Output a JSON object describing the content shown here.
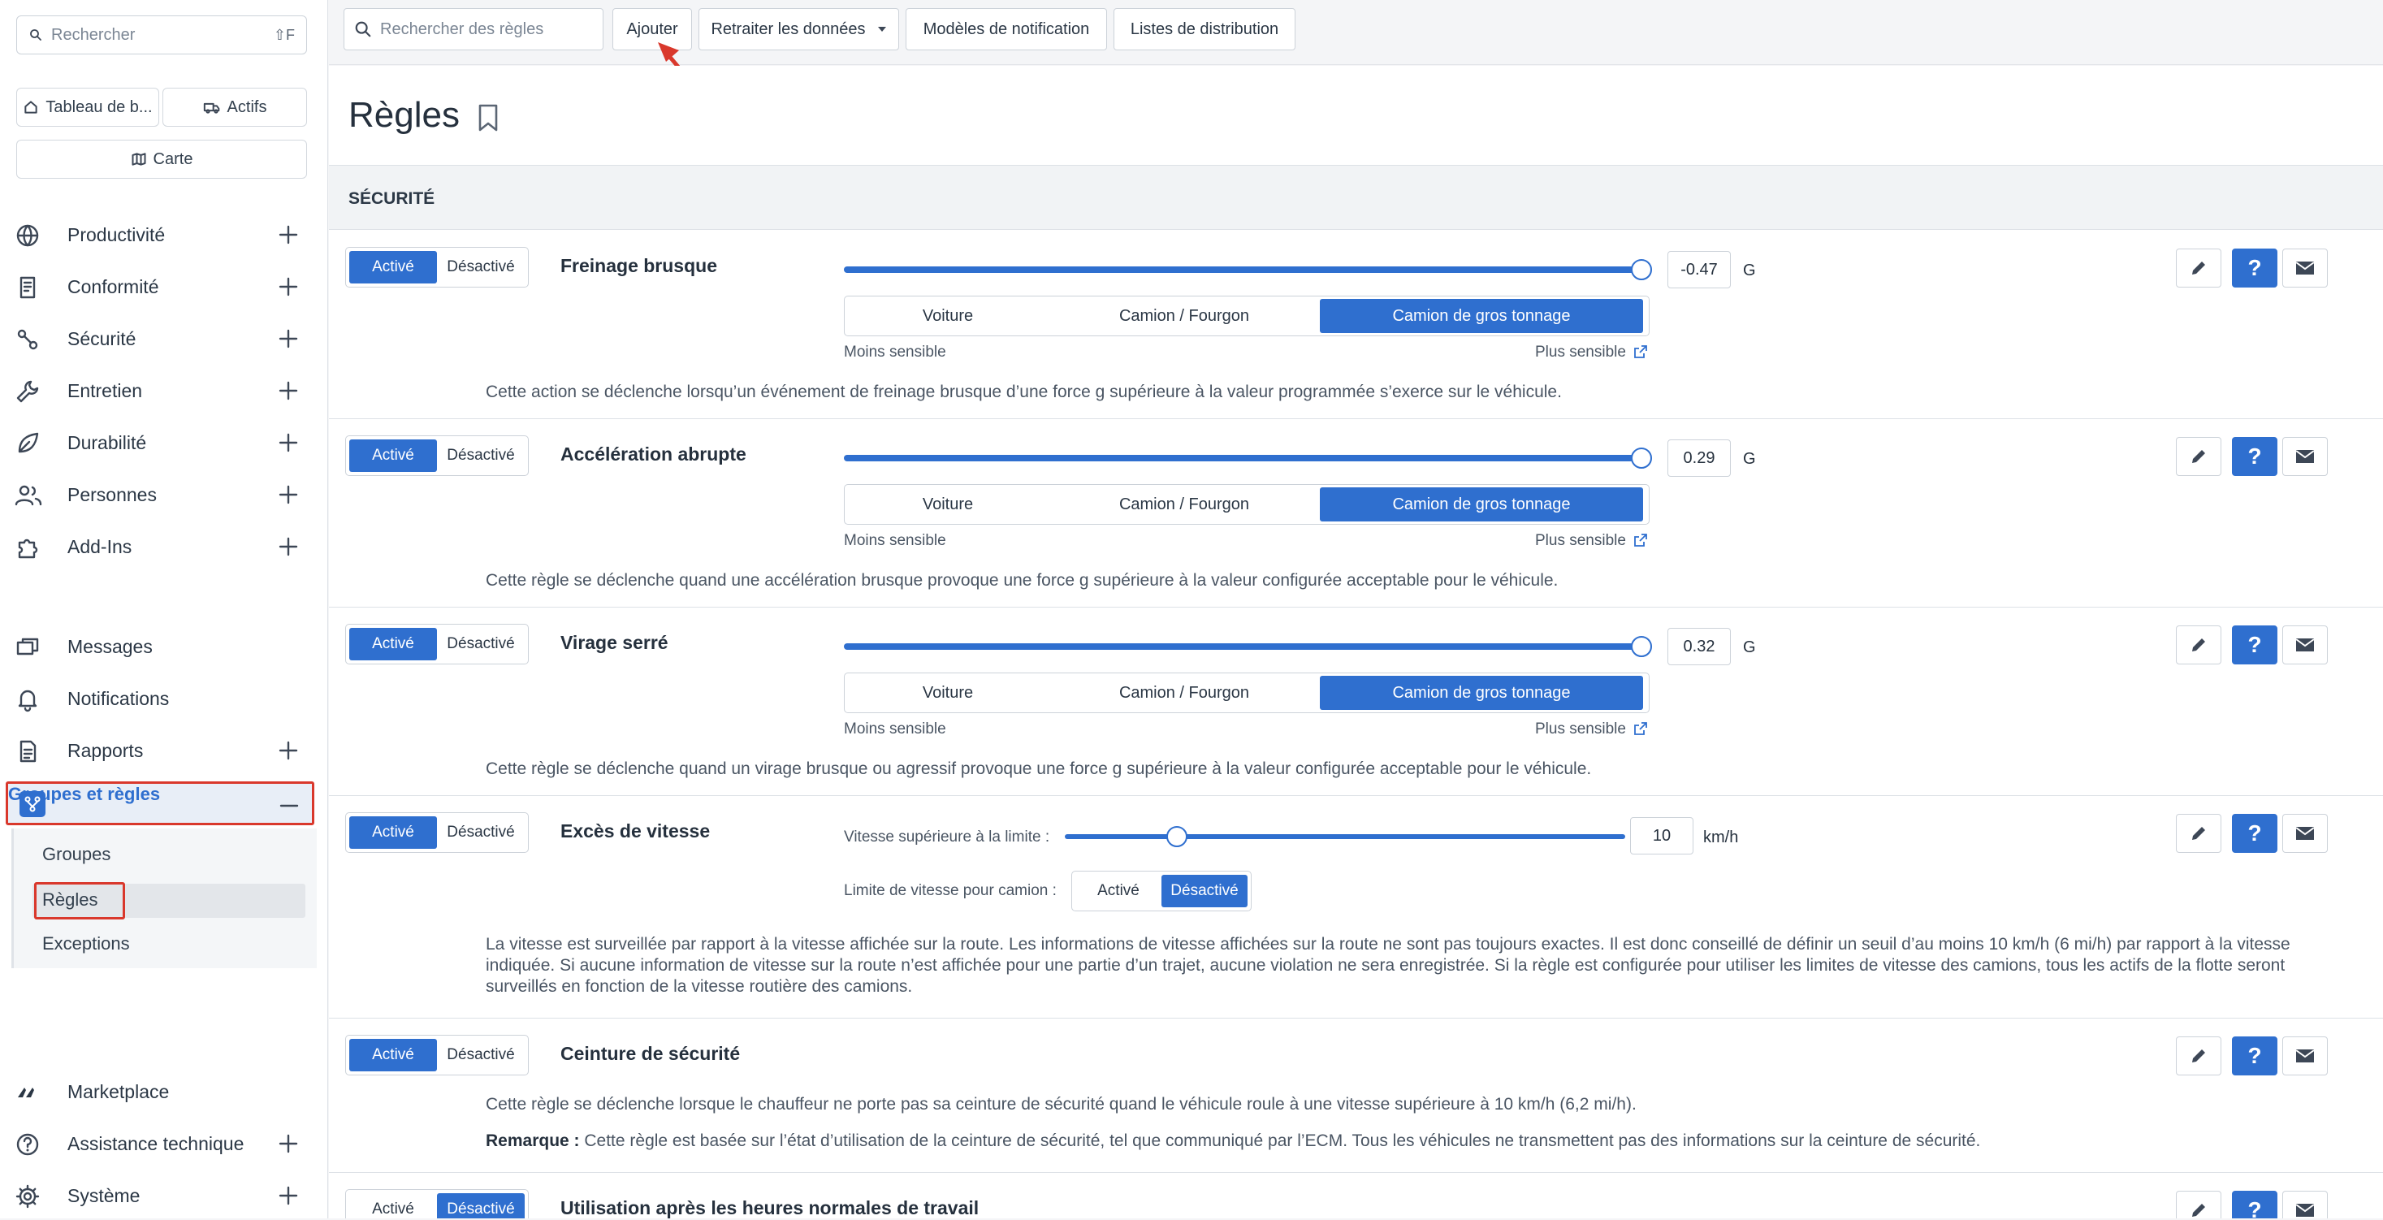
{
  "sidebar": {
    "search_placeholder": "Rechercher",
    "search_shortcut": "⇧F",
    "quick_links": [
      "Tableau de b...",
      "Actifs",
      "Carte"
    ],
    "nav": [
      {
        "label": "Productivité",
        "icon": "globe-icon",
        "expandable": true
      },
      {
        "label": "Conformité",
        "icon": "clipboard-icon",
        "expandable": true
      },
      {
        "label": "Sécurité",
        "icon": "road-icon",
        "expandable": true
      },
      {
        "label": "Entretien",
        "icon": "wrench-icon",
        "expandable": true
      },
      {
        "label": "Durabilité",
        "icon": "leaf-icon",
        "expandable": true
      },
      {
        "label": "Personnes",
        "icon": "people-icon",
        "expandable": true
      },
      {
        "label": "Add-Ins",
        "icon": "puzzle-icon",
        "expandable": true
      },
      {
        "label": "Messages",
        "icon": "messages-icon",
        "expandable": false
      },
      {
        "label": "Notifications",
        "icon": "bell-icon",
        "expandable": false
      },
      {
        "label": "Rapports",
        "icon": "report-icon",
        "expandable": true
      },
      {
        "label": "Groupes et règles",
        "icon": "groups-rules-icon",
        "expanded": true
      },
      {
        "label": "Marketplace",
        "icon": "marketplace-icon",
        "expandable": false
      },
      {
        "label": "Assistance technique",
        "icon": "help-circle-icon",
        "expandable": true
      },
      {
        "label": "Système",
        "icon": "gear-icon",
        "expandable": true
      }
    ],
    "sub_items": [
      "Groupes",
      "Règles",
      "Exceptions"
    ],
    "active_sub_item": "Règles"
  },
  "toolbar": {
    "search_placeholder": "Rechercher des règles",
    "add_label": "Ajouter",
    "reprocess_label": "Retraiter les données",
    "templates_label": "Modèles de notification",
    "distribution_label": "Listes de distribution"
  },
  "page": {
    "title": "Règles",
    "section": "SÉCURITÉ"
  },
  "common": {
    "on_label": "Activé",
    "off_label": "Désactivé",
    "vehicle_types": [
      "Voiture",
      "Camion / Fourgon",
      "Camion de gros tonnage"
    ],
    "less_sensitive": "Moins sensible",
    "more_sensitive": "Plus sensible",
    "unit_g": "G",
    "unit_kmh": "km/h"
  },
  "rules": [
    {
      "name": "Freinage brusque",
      "state": "Activé",
      "value": "-0.47",
      "vehicle": "Camion de gros tonnage",
      "level": 1.0,
      "description": "Cette action se déclenche lorsqu’un événement de freinage brusque d’une force g supérieure à la valeur programmée s’exerce sur le véhicule."
    },
    {
      "name": "Accélération abrupte",
      "state": "Activé",
      "value": "0.29",
      "vehicle": "Camion de gros tonnage",
      "level": 1.0,
      "description": "Cette règle se déclenche quand une accélération brusque provoque une force g supérieure à la valeur configurée acceptable pour le véhicule."
    },
    {
      "name": "Virage serré",
      "state": "Activé",
      "value": "0.32",
      "vehicle": "Camion de gros tonnage",
      "level": 1.0,
      "description": "Cette règle se déclenche quand un virage brusque ou agressif provoque une force g supérieure à la valeur configurée acceptable pour le véhicule."
    },
    {
      "name": "Excès de vitesse",
      "state": "Activé",
      "speed_label": "Vitesse supérieure à la limite :",
      "speed_value": "10",
      "level": 0.2,
      "truck_limit_label": "Limite de vitesse pour camion :",
      "truck_limit_state": "Désactivé",
      "description": "La vitesse est surveillée par rapport à la vitesse affichée sur la route. Les informations de vitesse affichées sur la route ne sont pas toujours exactes. Il est donc conseillé de définir un seuil d’au moins 10 km/h (6 mi/h) par rapport à la vitesse indiquée. Si aucune information de vitesse sur la route n’est affichée pour une partie d’un trajet, aucune violation ne sera enregistrée. Si la règle est configurée pour utiliser les limites de vitesse des camions, tous les actifs de la flotte seront surveillés en fonction de la vitesse routière des camions."
    },
    {
      "name": "Ceinture de sécurité",
      "state": "Activé",
      "description": "Cette règle se déclenche lorsque le chauffeur ne porte pas sa ceinture de sécurité quand le véhicule roule à une vitesse supérieure à 10 km/h (6,2 mi/h).",
      "note_label": "Remarque :",
      "note": "Cette règle est basée sur l’état d’utilisation de la ceinture de sécurité, tel que communiqué par l’ECM. Tous les véhicules ne transmettent pas des informations sur la ceinture de sécurité."
    },
    {
      "name": "Utilisation après les heures normales de travail",
      "state": "Désactivé"
    }
  ],
  "colors": {
    "accent": "#2f6fcf",
    "highlight": "#d9382c"
  }
}
